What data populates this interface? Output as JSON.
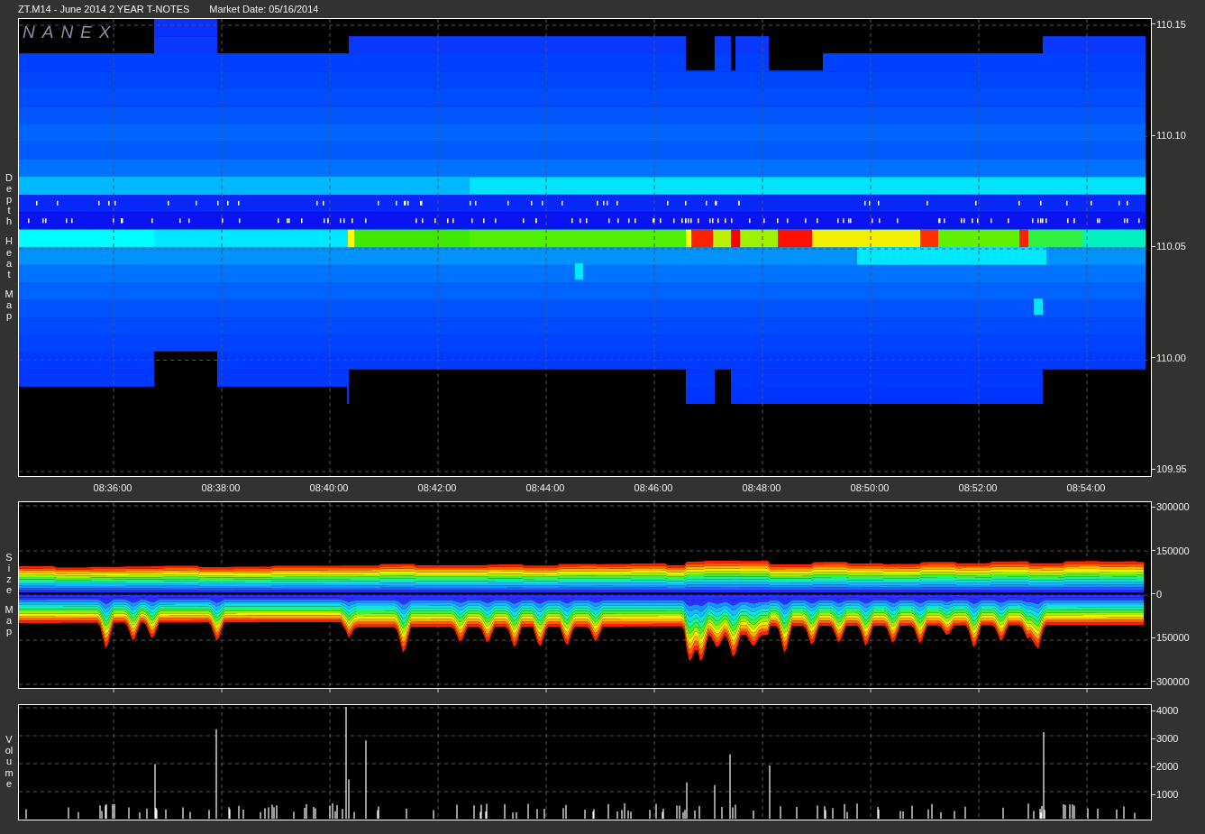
{
  "header": {
    "title": "ZT.M14 - June 2014 2 YEAR T-NOTES",
    "market_date": "Market Date: 05/16/2014"
  },
  "panels": [
    {
      "kind": "heatmap",
      "label": "Depth Heat Map",
      "logo": "NANEX",
      "yticks": [
        "110.15",
        "110.10",
        "110.05",
        "110.00",
        "109.95"
      ],
      "xticks": [
        "08:36:00",
        "08:38:00",
        "08:40:00",
        "08:42:00",
        "08:44:00",
        "08:46:00",
        "08:48:00",
        "08:50:00",
        "08:52:00",
        "08:54:00"
      ]
    },
    {
      "kind": "sizemap",
      "label": "Size Map",
      "yticks": [
        "300000",
        "150000",
        "0",
        "150000",
        "300000"
      ]
    },
    {
      "kind": "volume",
      "label": "Volume",
      "yticks": [
        "4000",
        "3000",
        "2000",
        "1000"
      ]
    }
  ]
}
